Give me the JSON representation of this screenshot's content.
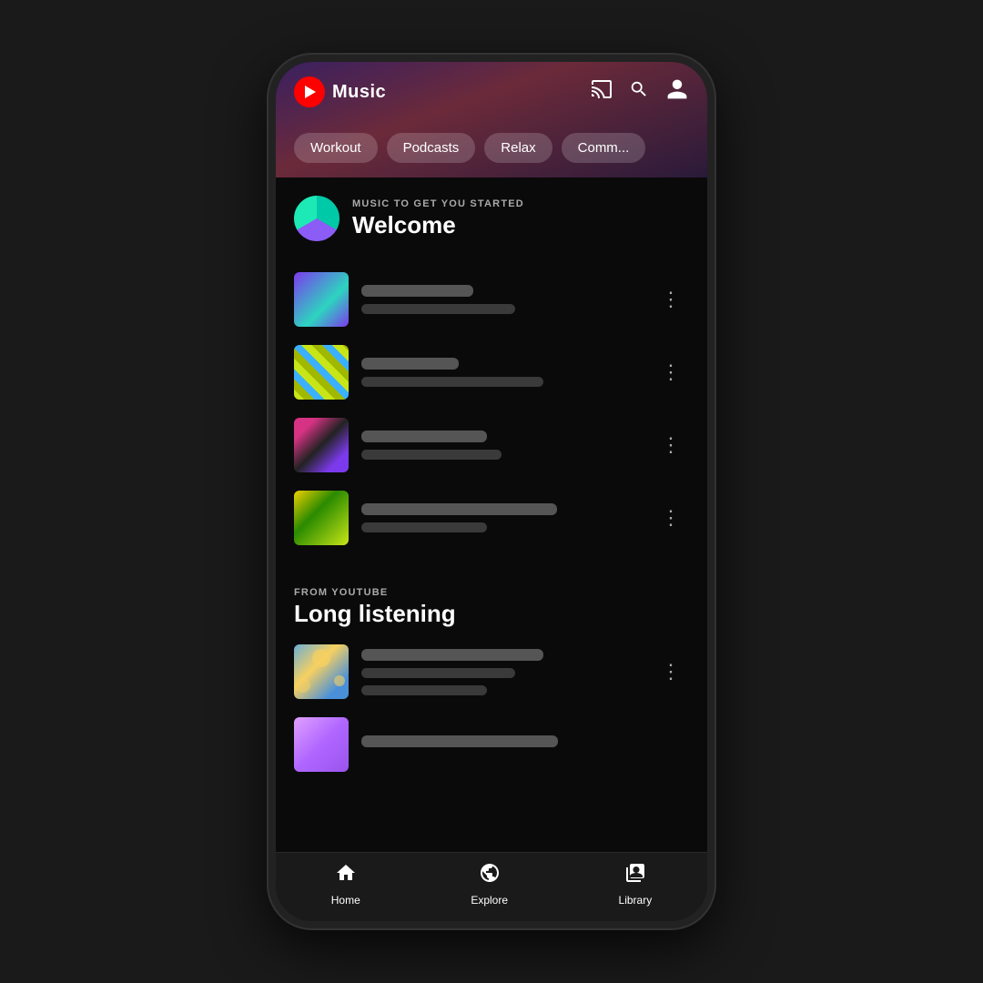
{
  "app": {
    "name": "Music"
  },
  "header": {
    "logo_text": "Music",
    "cast_label": "cast",
    "search_label": "search",
    "account_label": "account"
  },
  "chips": [
    {
      "label": "Workout",
      "id": "workout"
    },
    {
      "label": "Podcasts",
      "id": "podcasts"
    },
    {
      "label": "Relax",
      "id": "relax"
    },
    {
      "label": "Comm...",
      "id": "community"
    }
  ],
  "sections": [
    {
      "id": "welcome",
      "label": "MUSIC TO GET YOU STARTED",
      "title": "Welcome",
      "tracks": [
        {
          "id": 1
        },
        {
          "id": 2
        },
        {
          "id": 3
        },
        {
          "id": 4
        }
      ]
    },
    {
      "id": "long-listening",
      "label": "FROM YOUTUBE",
      "title": "Long listening",
      "tracks": [
        {
          "id": 5
        },
        {
          "id": 6
        }
      ]
    }
  ],
  "nav": {
    "items": [
      {
        "id": "home",
        "label": "Home",
        "icon": "🏠"
      },
      {
        "id": "explore",
        "label": "Explore",
        "icon": "🧭"
      },
      {
        "id": "library",
        "label": "Library",
        "icon": "🎵"
      }
    ]
  }
}
